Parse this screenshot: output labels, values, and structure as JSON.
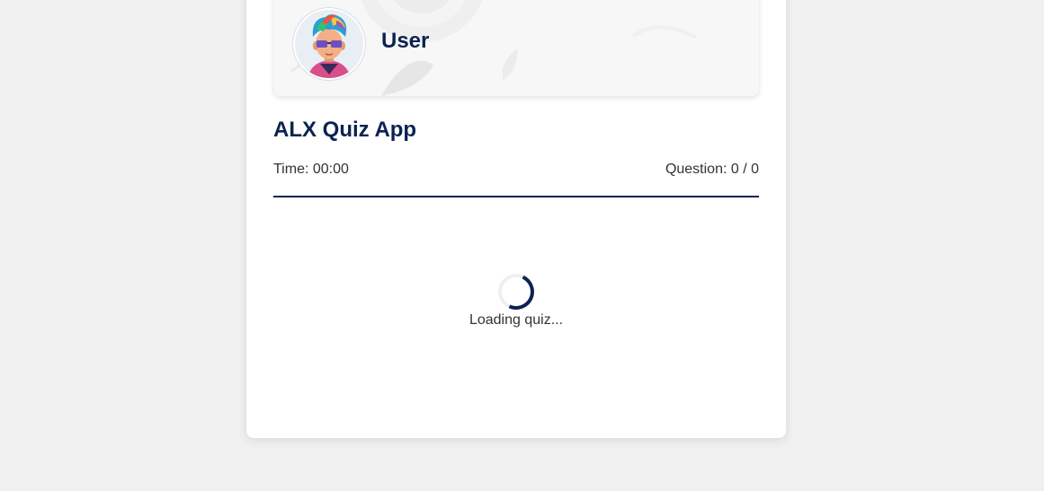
{
  "profile": {
    "username": "User",
    "avatar_icon": "user-avatar-icon"
  },
  "quiz": {
    "title": "ALX Quiz App",
    "time_text": "Time: 00:00",
    "question_text": "Question: 0 / 0",
    "loading_text": "Loading quiz..."
  },
  "colors": {
    "page_background": "#f0f0f0",
    "card_background": "#ffffff",
    "primary_navy": "#0a2351",
    "text": "#333333"
  }
}
